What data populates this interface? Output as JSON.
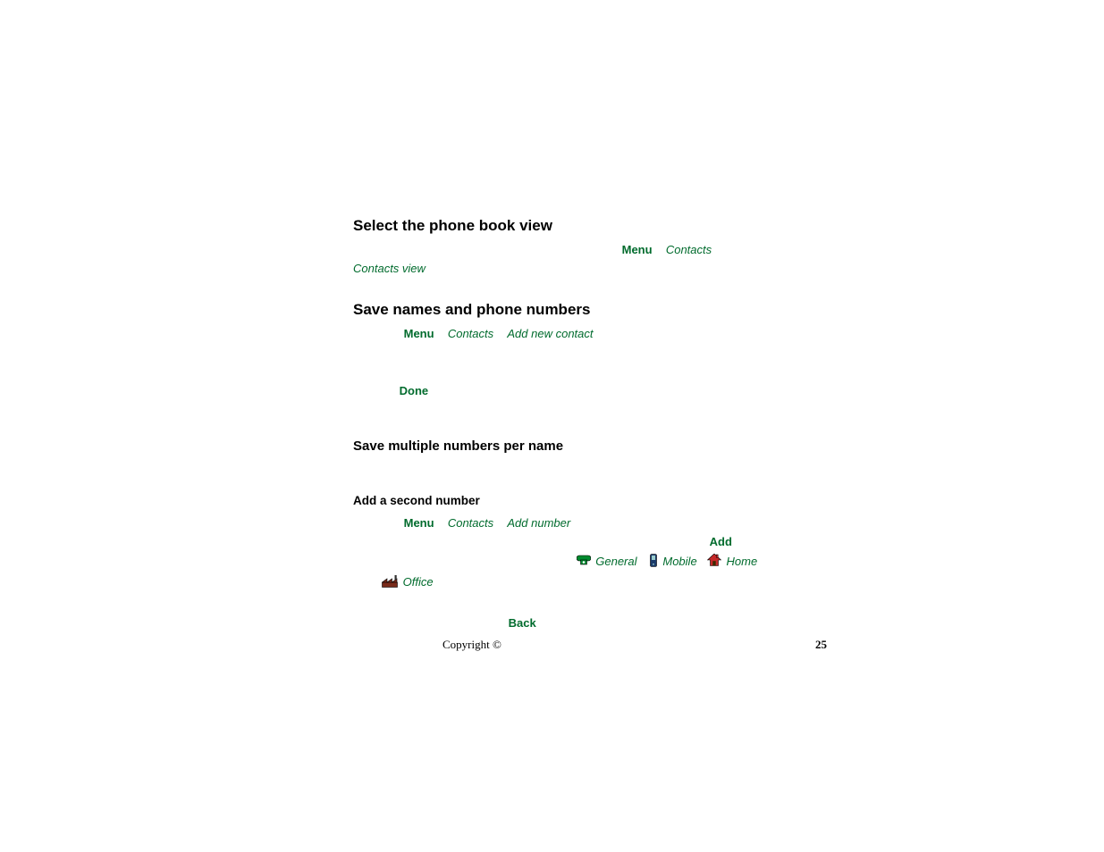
{
  "sections": {
    "select_view": {
      "heading": "Select the phone book view",
      "menu": "Menu",
      "contacts": "Contacts",
      "contacts_view": "Contacts view"
    },
    "save_names": {
      "heading": "Save names and phone numbers",
      "menu": "Menu",
      "contacts": "Contacts",
      "add_new": "Add new contact",
      "done": "Done"
    },
    "save_multiple": {
      "heading": "Save multiple numbers per name"
    },
    "add_second": {
      "heading": "Add a second number",
      "menu": "Menu",
      "contacts": "Contacts",
      "add_number": "Add number",
      "add": "Add",
      "types": {
        "general": "General",
        "mobile": "Mobile",
        "home": "Home",
        "office": "Office"
      },
      "back": "Back"
    }
  },
  "footer": {
    "copyright": "Copyright ©",
    "page": "25"
  }
}
